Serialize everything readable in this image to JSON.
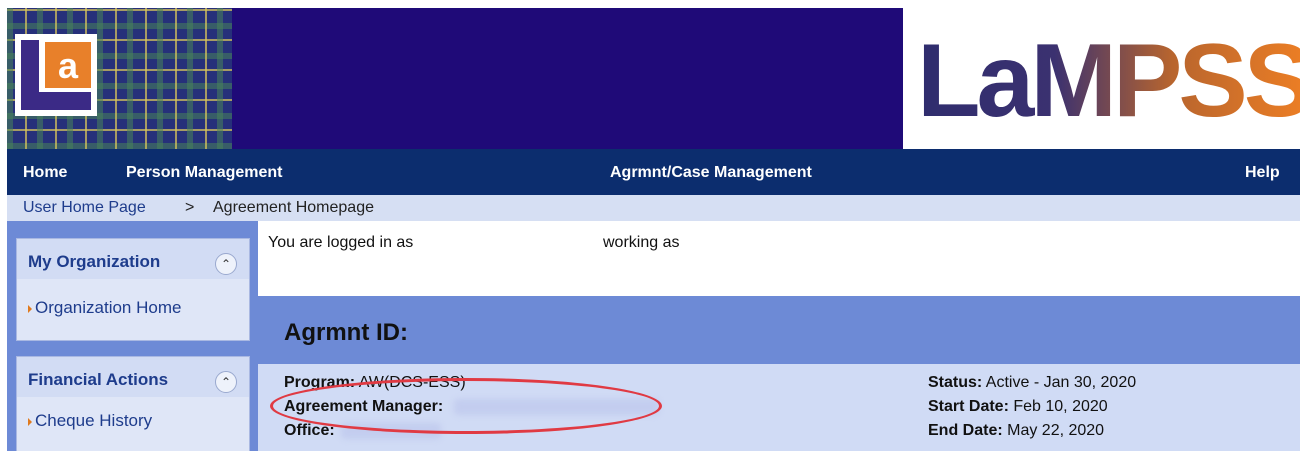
{
  "header": {
    "logo_small_text": "La",
    "brand_name": "LaMPSS",
    "colors": {
      "header_bg": "#1f0a78",
      "brand_orange": "#e8802a",
      "brand_purple": "#2f2d6e"
    }
  },
  "nav": {
    "items": [
      {
        "label": "Home"
      },
      {
        "label": "Person Management"
      },
      {
        "label": "Agrmnt/Case Management"
      },
      {
        "label": "Help"
      }
    ]
  },
  "breadcrumb": {
    "link": "User Home Page",
    "separator": ">",
    "current": "Agreement Homepage"
  },
  "sidebar": {
    "boxes": [
      {
        "title": "My Organization",
        "items": [
          "Organization Home"
        ],
        "icon": "collapse-up-icon"
      },
      {
        "title": "Financial Actions",
        "items": [
          "Cheque History"
        ],
        "icon": "collapse-up-icon"
      }
    ]
  },
  "session": {
    "logged_in_label": "You are logged in as",
    "working_as_label": "working as"
  },
  "agreement": {
    "title": "Agrmnt ID:",
    "program_label": "Program:",
    "program_value": "AW(DCS-ESS)",
    "manager_label": "Agreement Manager:",
    "office_label": "Office:",
    "status_label": "Status:",
    "status_value": "Active - Jan 30, 2020",
    "start_label": "Start Date:",
    "start_value": "Feb 10, 2020",
    "end_label": "End Date:",
    "end_value": "May 22, 2020"
  }
}
